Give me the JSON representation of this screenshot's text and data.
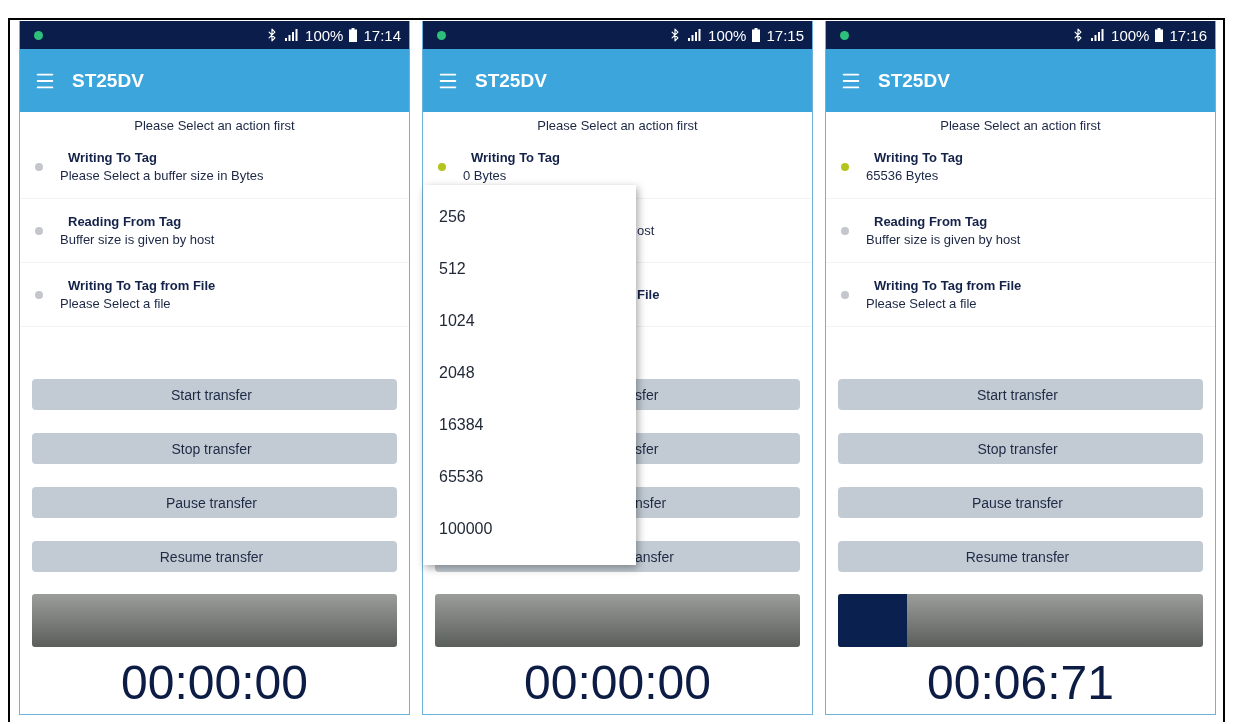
{
  "screens": [
    {
      "status": {
        "battery": "100%",
        "time": "17:14"
      },
      "title": "ST25DV",
      "prompt": "Please Select an action first",
      "actions": [
        {
          "title": "Writing To Tag",
          "subtitle": "Please Select a buffer size in Bytes",
          "active": false
        },
        {
          "title": "Reading From Tag",
          "subtitle": "Buffer size is given by host",
          "active": false
        },
        {
          "title": "Writing To Tag from File",
          "subtitle": "Please Select a file",
          "active": false
        }
      ],
      "buttons": [
        "Start transfer",
        "Stop transfer",
        "Pause transfer",
        "Resume transfer"
      ],
      "progress": {
        "level": 0
      },
      "timer": "00:00:00"
    },
    {
      "status": {
        "battery": "100%",
        "time": "17:15"
      },
      "title": "ST25DV",
      "prompt": "Please Select an action first",
      "actions": [
        {
          "title": "Writing To Tag",
          "subtitle": "0 Bytes",
          "active": true
        },
        {
          "subtitle": "ost"
        },
        {
          "title": "File"
        }
      ],
      "menu": {
        "options": [
          "256",
          "512",
          "1024",
          "2048",
          "16384",
          "65536",
          "100000"
        ]
      },
      "buttons": [
        "sfer",
        "sfer",
        "nsfer",
        "ansfer"
      ],
      "progress": {
        "level": 0
      },
      "timer": "00:00:00"
    },
    {
      "status": {
        "battery": "100%",
        "time": "17:16"
      },
      "title": "ST25DV",
      "prompt": "Please Select an action first",
      "actions": [
        {
          "title": "Writing To Tag",
          "subtitle": "65536 Bytes",
          "active": true
        },
        {
          "title": "Reading From Tag",
          "subtitle": "Buffer size is given by host",
          "active": false
        },
        {
          "title": "Writing To Tag from File",
          "subtitle": "Please Select a file",
          "active": false
        }
      ],
      "buttons": [
        "Start transfer",
        "Stop transfer",
        "Pause transfer",
        "Resume transfer"
      ],
      "progress": {
        "level": 0.19
      },
      "timer": "00:06:71"
    }
  ]
}
